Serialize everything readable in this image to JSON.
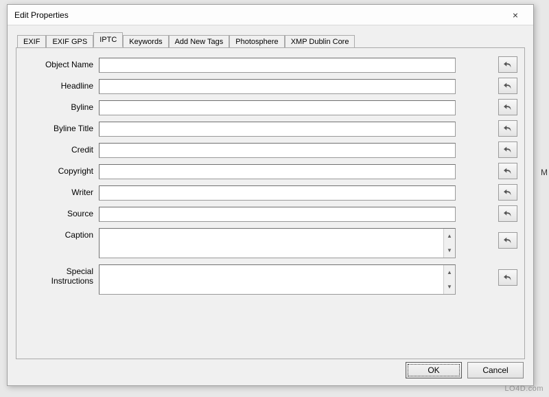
{
  "dialog": {
    "title": "Edit Properties",
    "close_icon": "×"
  },
  "tabs": [
    {
      "label": "EXIF"
    },
    {
      "label": "EXIF GPS"
    },
    {
      "label": "IPTC"
    },
    {
      "label": "Keywords"
    },
    {
      "label": "Add New Tags"
    },
    {
      "label": "Photosphere"
    },
    {
      "label": "XMP Dublin Core"
    }
  ],
  "active_tab_index": 2,
  "fields": [
    {
      "label": "Object Name",
      "value": "",
      "type": "text"
    },
    {
      "label": "Headline",
      "value": "",
      "type": "text"
    },
    {
      "label": "Byline",
      "value": "",
      "type": "text"
    },
    {
      "label": "Byline Title",
      "value": "",
      "type": "text"
    },
    {
      "label": "Credit",
      "value": "",
      "type": "text"
    },
    {
      "label": "Copyright",
      "value": "",
      "type": "text"
    },
    {
      "label": "Writer",
      "value": "",
      "type": "text"
    },
    {
      "label": "Source",
      "value": "",
      "type": "text"
    },
    {
      "label": "Caption",
      "value": "",
      "type": "textarea"
    },
    {
      "label": "Special Instructions",
      "value": "",
      "type": "textarea"
    }
  ],
  "buttons": {
    "ok": "OK",
    "cancel": "Cancel"
  },
  "watermark": "LO4D.com",
  "bg_hint": "M"
}
